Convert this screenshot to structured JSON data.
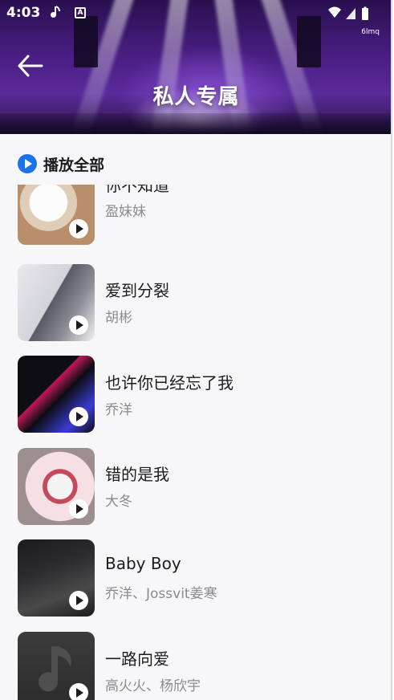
{
  "status_bar": {
    "time": "4:03",
    "notif_icon_a": "music-note-icon",
    "notif_icon_b_text": "A",
    "net_rate": "6lmq"
  },
  "header": {
    "back_icon": "arrow-left-icon",
    "title": "私人专属"
  },
  "play_all": {
    "label": "播放全部"
  },
  "songs": [
    {
      "title": "你不知道",
      "artist": "盈妹妹",
      "colors": [
        "#e9dfd4",
        "#b98f6b",
        "#fdfdfd"
      ]
    },
    {
      "title": "爱到分裂",
      "artist": "胡彬",
      "colors": [
        "#dcdde2",
        "#5a5a64",
        "#f2f2f2"
      ]
    },
    {
      "title": "也许你已经忘了我",
      "artist": "乔洋",
      "colors": [
        "#0d0d12",
        "#c2185b",
        "#3b3bd6"
      ]
    },
    {
      "title": "错的是我",
      "artist": "大冬",
      "colors": [
        "#f7dfe6",
        "#c44a5a",
        "#9e8f8f"
      ]
    },
    {
      "title": "Baby Boy",
      "artist": "乔洋、Jossvit姜寒",
      "colors": [
        "#1b1b1e",
        "#4a4a4a",
        "#d9c26b"
      ]
    },
    {
      "title": "一路向爱",
      "artist": "高火火、杨欣宇",
      "colors": [
        "#2b2b2b",
        "#3c3c3c",
        "#4a4a4a"
      ]
    }
  ]
}
